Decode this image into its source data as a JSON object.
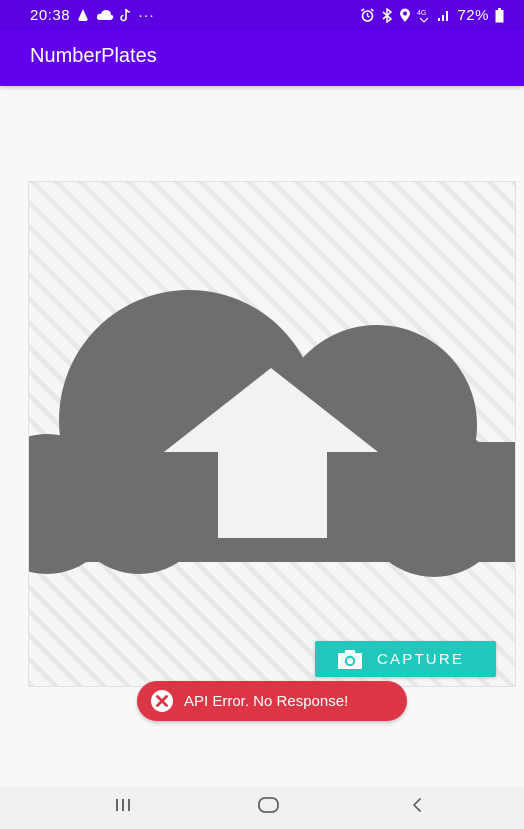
{
  "status_bar": {
    "time": "20:38",
    "dots": "···",
    "network": "4G",
    "battery": "72%",
    "left_icons": [
      "vlc-icon",
      "cloud-icon",
      "tiktok-icon"
    ],
    "right_icons": [
      "alarm-icon",
      "bluetooth-icon",
      "location-icon",
      "volte-icon",
      "signal-icon",
      "battery-icon"
    ]
  },
  "app_bar": {
    "title": "NumberPlates",
    "color": "#6200ee"
  },
  "image_placeholder": {
    "icon": "cloud-upload-icon",
    "icon_color": "#6e6e6e"
  },
  "capture_button": {
    "label": "CAPTURE",
    "icon": "camera-icon",
    "color": "#20c9bb"
  },
  "error_toast": {
    "message": "API Error. No Response!",
    "icon": "error-circle-icon",
    "color": "#dc3545"
  },
  "nav_bar": {
    "buttons": [
      "recent-apps-icon",
      "home-icon",
      "back-icon"
    ]
  }
}
